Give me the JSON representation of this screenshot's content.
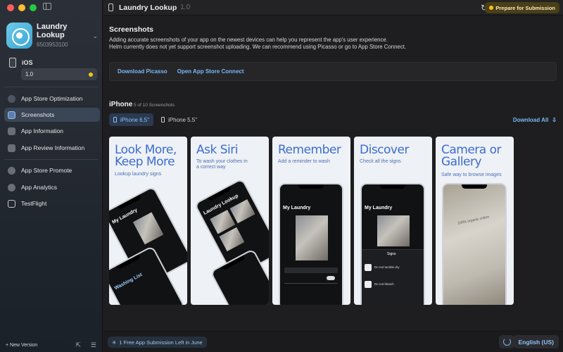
{
  "app": {
    "name": "Laundry Lookup",
    "id": "6503953100",
    "version_header": "1.0"
  },
  "sidebar": {
    "platform": "iOS",
    "version": "1.0",
    "items": [
      {
        "label": "App Store Optimization",
        "icon": "globe-icon"
      },
      {
        "label": "Screenshots",
        "icon": "screenshots-icon",
        "active": true
      },
      {
        "label": "App Information",
        "icon": "info-icon"
      },
      {
        "label": "App Review Information",
        "icon": "review-icon"
      },
      {
        "label": "App Store Promote",
        "icon": "promote-icon"
      },
      {
        "label": "App Analytics",
        "icon": "analytics-icon"
      },
      {
        "label": "TestFlight",
        "icon": "testflight-icon"
      }
    ],
    "new_version": "+ New Version"
  },
  "header": {
    "title": "Laundry Lookup",
    "prepare_label": "Prepare for Submission"
  },
  "screenshots_section": {
    "title": "Screenshots",
    "desc_line1": "Adding accurate screenshots of your app on the newest devices can help you represent the app's user experience.",
    "desc_line2": "Helm currently does not yet support screenshot uploading. We can recommend using Picasso or go to App Store Connect.",
    "link_picasso": "Download Picasso",
    "link_asc": "Open App Store Connect"
  },
  "iphone": {
    "title": "iPhone",
    "count": "5 of 10 Screenshots",
    "tabs": [
      "iPhone 6.5\"",
      "iPhone 5.5\""
    ],
    "download_all": "Download All"
  },
  "shots": [
    {
      "headline1": "Look More,",
      "headline2": "Keep More",
      "sub1": "Lookup laundry signs",
      "sub2": ""
    },
    {
      "headline1": "Ask Siri",
      "headline2": "",
      "sub1": "To wash your clothes in",
      "sub2": "a correct way"
    },
    {
      "headline1": "Remember",
      "headline2": "",
      "sub1": "Add a reminder to wash",
      "sub2": ""
    },
    {
      "headline1": "Discover",
      "headline2": "",
      "sub1": "Check all the signs",
      "sub2": ""
    },
    {
      "headline1": "Camera or",
      "headline2": "Gallery",
      "sub1": "Safe way to browse images",
      "sub2": ""
    }
  ],
  "shot_screens": {
    "my_laundry": "My Laundry",
    "laundry_lookup": "Laundry Lookup",
    "washing_list": "Washing List",
    "signs": "Signs",
    "do_not_bleach": "Do not bleach",
    "do_not_tumble_dry": "Do not tumble dry",
    "garment_label": "100% organic cotton"
  },
  "footer": {
    "submission_left": "1 Free App Submission Left in June",
    "language": "English (US)"
  },
  "colors": {
    "accent": "#7ab8f5",
    "headline_blue": "#3c6dcf",
    "status_yellow": "#f5c318"
  }
}
